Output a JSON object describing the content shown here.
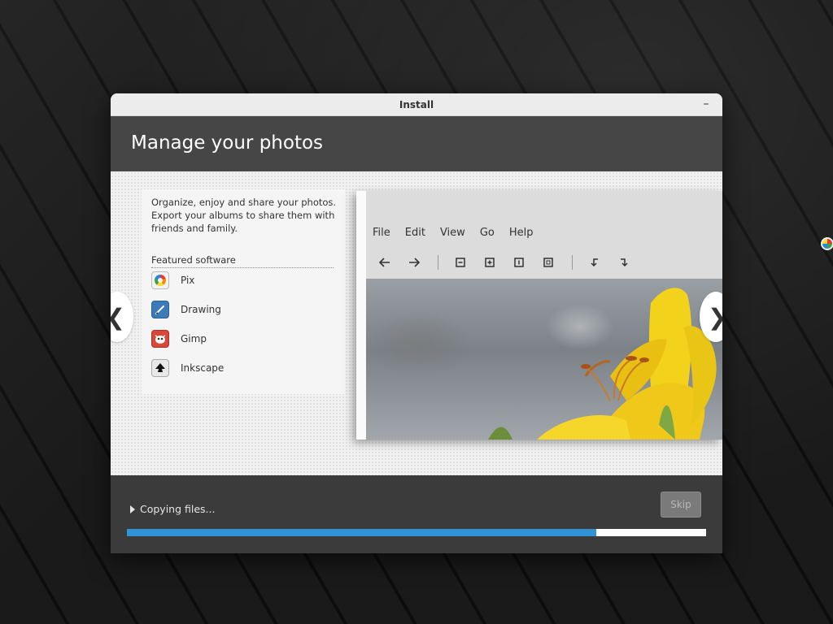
{
  "window": {
    "title": "Install",
    "minimize_label": "–"
  },
  "slide": {
    "title": "Manage your photos",
    "description": "Organize, enjoy and share your photos. Export your albums to share them with friends and family.",
    "featured_heading": "Featured software",
    "apps": [
      {
        "label": "Pix",
        "icon": "pix-icon"
      },
      {
        "label": "Drawing",
        "icon": "drawing-icon"
      },
      {
        "label": "Gimp",
        "icon": "gimp-icon"
      },
      {
        "label": "Inkscape",
        "icon": "inkscape-icon"
      }
    ],
    "screenshot_menu": [
      "File",
      "Edit",
      "View",
      "Go",
      "Help"
    ],
    "nav_prev": "❮",
    "nav_next": "❯"
  },
  "footer": {
    "status": "Copying files...",
    "skip_label": "Skip",
    "progress": 0.81,
    "progress_color": "#2f93d6"
  }
}
